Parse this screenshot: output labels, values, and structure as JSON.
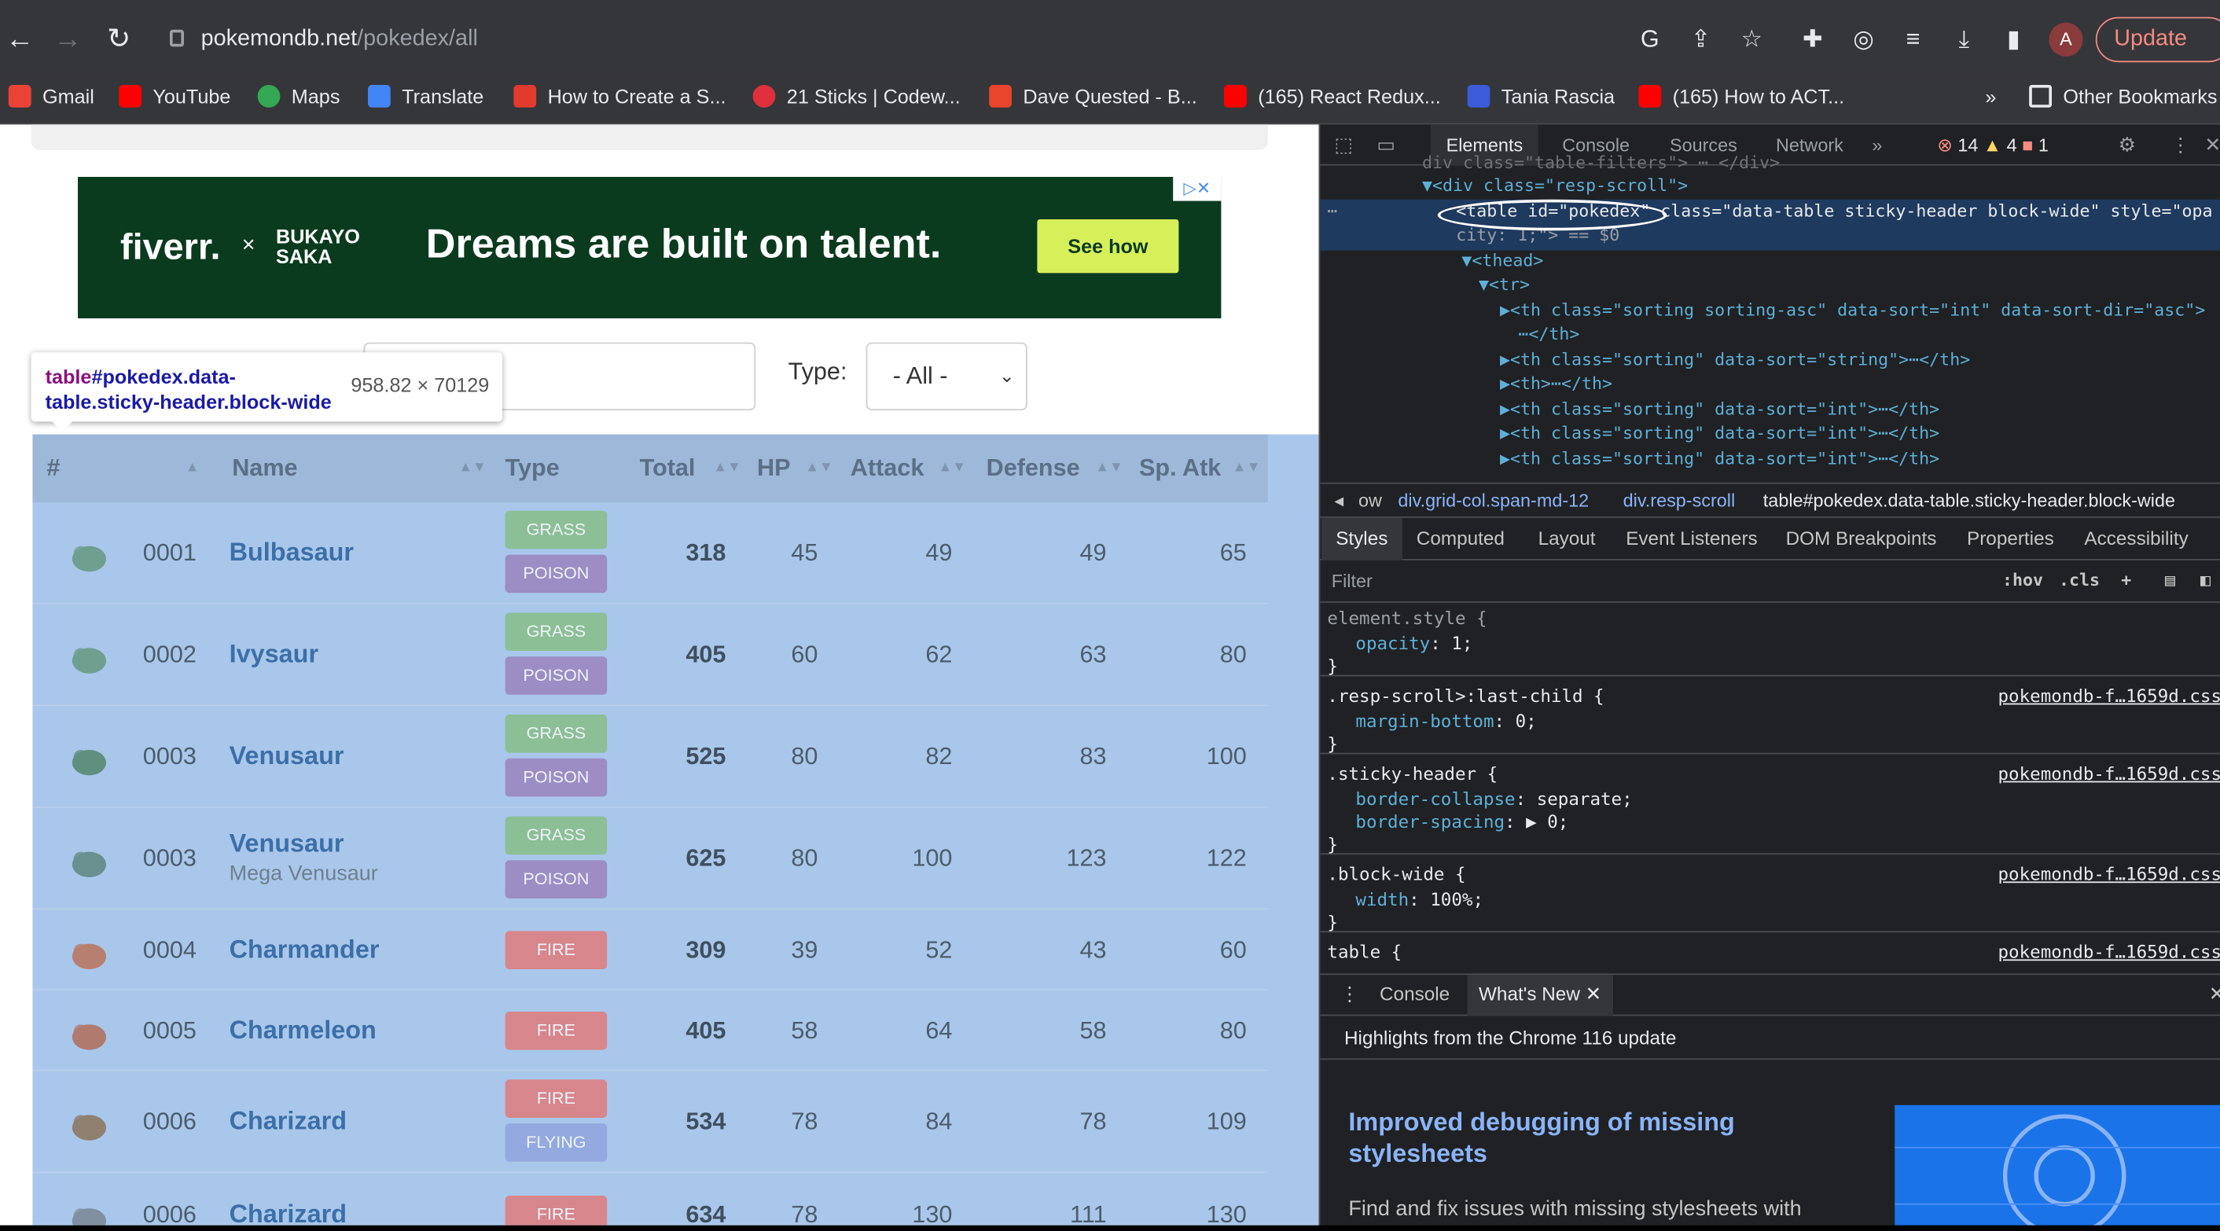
{
  "browser": {
    "url_host": "pokemondb.net",
    "url_path": "/pokedex/all",
    "update_label": "Update",
    "profile_initial": "A",
    "bookmarks": [
      {
        "label": "Gmail",
        "color": "#ea4335"
      },
      {
        "label": "YouTube",
        "color": "#ff0000"
      },
      {
        "label": "Maps",
        "color": "#34a853"
      },
      {
        "label": "Translate",
        "color": "#4285f4"
      },
      {
        "label": "How to Create a S...",
        "color": "#e23b2e"
      },
      {
        "label": "21 Sticks | Codew...",
        "color": "#e0303b"
      },
      {
        "label": "Dave Quested - B...",
        "color": "#e8452c"
      },
      {
        "label": "(165) React Redux...",
        "color": "#ff0000"
      },
      {
        "label": "Tania Rascia",
        "color": "#3b5bdb"
      },
      {
        "label": "(165) How to ACT...",
        "color": "#ff0000"
      }
    ],
    "more_bookmarks": "»",
    "other_bookmarks": "Other Bookmarks"
  },
  "ad": {
    "brand": "fiverr.",
    "times": "×",
    "partner": "BUKAYO SAKA",
    "tagline": "Dreams are built on talent.",
    "cta": "See how"
  },
  "filters": {
    "type_label": "Type:",
    "type_value": "- All -"
  },
  "tooltip": {
    "tag": "table",
    "selector": "#pokedex.data-table.sticky-header.block-wide",
    "dimensions": "958.82 × 70129"
  },
  "table": {
    "headers": [
      "#",
      "Name",
      "Type",
      "Total",
      "HP",
      "Attack",
      "Defense",
      "Sp. Atk"
    ],
    "rows": [
      {
        "num": "0001",
        "name": "Bulbasaur",
        "sub": "",
        "types": [
          "GRASS",
          "POISON"
        ],
        "total": "318",
        "hp": "45",
        "attack": "49",
        "defense": "49",
        "spatk": "65"
      },
      {
        "num": "0002",
        "name": "Ivysaur",
        "sub": "",
        "types": [
          "GRASS",
          "POISON"
        ],
        "total": "405",
        "hp": "60",
        "attack": "62",
        "defense": "63",
        "spatk": "80"
      },
      {
        "num": "0003",
        "name": "Venusaur",
        "sub": "",
        "types": [
          "GRASS",
          "POISON"
        ],
        "total": "525",
        "hp": "80",
        "attack": "82",
        "defense": "83",
        "spatk": "100"
      },
      {
        "num": "0003",
        "name": "Venusaur",
        "sub": "Mega Venusaur",
        "types": [
          "GRASS",
          "POISON"
        ],
        "total": "625",
        "hp": "80",
        "attack": "100",
        "defense": "123",
        "spatk": "122"
      },
      {
        "num": "0004",
        "name": "Charmander",
        "sub": "",
        "types": [
          "FIRE"
        ],
        "total": "309",
        "hp": "39",
        "attack": "52",
        "defense": "43",
        "spatk": "60"
      },
      {
        "num": "0005",
        "name": "Charmeleon",
        "sub": "",
        "types": [
          "FIRE"
        ],
        "total": "405",
        "hp": "58",
        "attack": "64",
        "defense": "58",
        "spatk": "80"
      },
      {
        "num": "0006",
        "name": "Charizard",
        "sub": "",
        "types": [
          "FIRE",
          "FLYING"
        ],
        "total": "534",
        "hp": "78",
        "attack": "84",
        "defense": "78",
        "spatk": "109"
      },
      {
        "num": "0006",
        "name": "Charizard",
        "sub": "",
        "types": [
          "FIRE"
        ],
        "total": "634",
        "hp": "78",
        "attack": "130",
        "defense": "111",
        "spatk": "130"
      }
    ],
    "type_colors": {
      "GRASS": "#8cbf96",
      "POISON": "#9c8dc4",
      "FIRE": "#d7868c",
      "FLYING": "#93a9e0"
    }
  },
  "devtools": {
    "tabs": [
      "Elements",
      "Console",
      "Sources",
      "Network",
      "»"
    ],
    "errors": "14",
    "warnings": "4",
    "issues": "1",
    "elements_lines": [
      "▼<div class=\"resp-scroll\">",
      "<table id=\"pokedex\" class=\"data-table sticky-header block-wide\" style=\"opa",
      "city: 1;\"> == $0",
      "▼<thead>",
      "▼<tr>",
      "▶<th class=\"sorting sorting-asc\" data-sort=\"int\" data-sort-dir=\"asc\">",
      "⋯</th>",
      "▶<th class=\"sorting\" data-sort=\"string\">⋯</th>",
      "▶<th>⋯</th>",
      "▶<th class=\"sorting\" data-sort=\"int\">⋯</th>",
      "▶<th class=\"sorting\" data-sort=\"int\">⋯</th>",
      "▶<th class=\"sorting\" data-sort=\"int\">⋯</th>"
    ],
    "breadcrumbs": [
      "ow",
      "div.grid-col.span-md-12",
      "div.resp-scroll",
      "table#pokedex.data-table.sticky-header.block-wide"
    ],
    "style_tabs": [
      "Styles",
      "Computed",
      "Layout",
      "Event Listeners",
      "DOM Breakpoints",
      "Properties",
      "Accessibility"
    ],
    "filter_placeholder": "Filter",
    "hov": ":hov",
    "cls": ".cls",
    "rules": [
      {
        "selector": "element.style {",
        "props": [
          [
            "opacity",
            "1;"
          ]
        ],
        "source": ""
      },
      {
        "selector": ".resp-scroll>:last-child {",
        "props": [
          [
            "margin-bottom",
            "0;"
          ]
        ],
        "source": "pokemondb-f…1659d.css"
      },
      {
        "selector": ".sticky-header {",
        "props": [
          [
            "border-collapse",
            "separate;"
          ],
          [
            "border-spacing",
            "▶ 0;"
          ]
        ],
        "source": "pokemondb-f…1659d.css"
      },
      {
        "selector": ".block-wide {",
        "props": [
          [
            "width",
            "100%;"
          ]
        ],
        "source": "pokemondb-f…1659d.css"
      },
      {
        "selector": "table {",
        "props": [],
        "source": "pokemondb-f…1659d.css"
      }
    ],
    "drawer_tabs": [
      "Console",
      "What's New"
    ],
    "whats_new_title": "Highlights from the Chrome 116 update",
    "whats_new_heading": "Improved debugging of missing stylesheets",
    "whats_new_body": "Find and fix issues with missing stylesheets with"
  }
}
